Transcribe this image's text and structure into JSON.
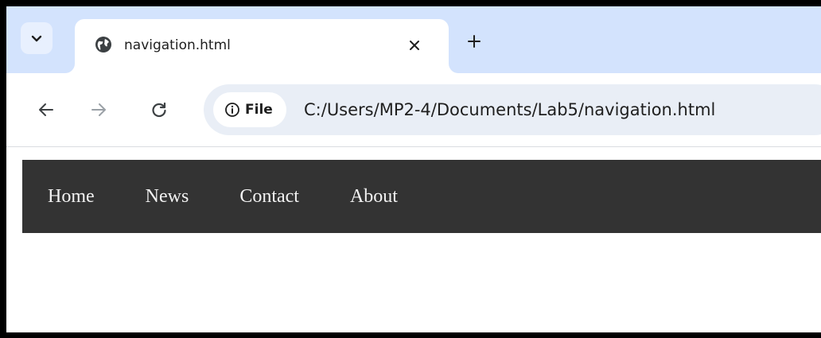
{
  "browser": {
    "tab": {
      "title": "navigation.html",
      "favicon_icon": "globe-icon",
      "close_icon": "close-icon"
    },
    "tab_search_icon": "chevron-down-icon",
    "new_tab_icon": "plus-icon",
    "toolbar": {
      "back_icon": "arrow-left-icon",
      "forward_icon": "arrow-right-icon",
      "reload_icon": "reload-icon",
      "site_info": {
        "icon": "info-icon",
        "label": "File"
      },
      "url": "C:/Users/MP2-4/Documents/Lab5/navigation.html"
    }
  },
  "page": {
    "nav_items": [
      {
        "label": "Home"
      },
      {
        "label": "News"
      },
      {
        "label": "Contact"
      },
      {
        "label": "About"
      }
    ]
  },
  "colors": {
    "tabstrip_bg": "#d3e3fd",
    "omnibox_bg": "#e9eef6",
    "nav_bg": "#333333",
    "nav_text": "#f2f2f2"
  }
}
